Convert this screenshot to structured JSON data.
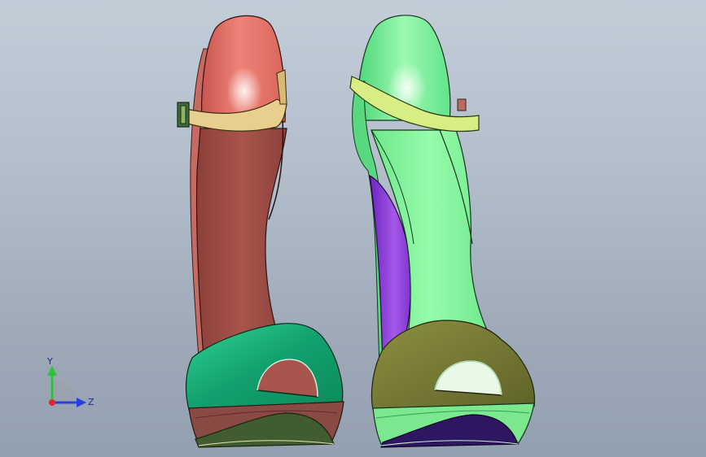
{
  "viewport": {
    "background_top": "#c3cdd8",
    "background_bottom": "#93a0b0"
  },
  "models": [
    {
      "name": "left-shoe",
      "colors": {
        "shank": "#9e4d45",
        "toe": "#e8766b",
        "strap": "#e6c98a",
        "peep_toe": "#1fae7a",
        "sole": "#4d6a3a",
        "platform": "#8a4a44"
      }
    },
    {
      "name": "right-shoe",
      "colors": {
        "shank": "#7ef59a",
        "toe": "#5ee38a",
        "strap": "#d7ee85",
        "inner": "#8e3fd6",
        "peep_toe": "#747834",
        "sole": "#3a1f6e",
        "platform": "#7be890"
      }
    }
  ],
  "triad": {
    "y_label": "Y",
    "z_label": "Z",
    "y_color": "#29c43a",
    "z_color": "#2b3ee0",
    "x_color": "#e0282b"
  }
}
